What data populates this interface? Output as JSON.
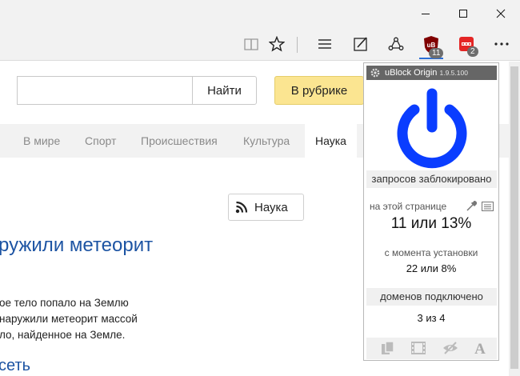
{
  "window_controls": {
    "minimize": "minimize-icon",
    "maximize": "maximize-icon",
    "close": "close-icon"
  },
  "toolbar": {
    "reading_view": "book-icon",
    "favorite": "star-icon",
    "hub": "hamburger-icon",
    "notes": "pen-icon",
    "share": "share-icon",
    "ublock_badge": "11",
    "ext2_badge": "2",
    "more": "more-icon"
  },
  "page": {
    "search_placeholder": "",
    "search_button": "Найти",
    "rubric_button": "В рубрике",
    "tabs": [
      "В мире",
      "Спорт",
      "Происшествия",
      "Культура",
      "Наука"
    ],
    "active_tab": "Наука",
    "rss_button": "Наука",
    "headline": "ружили метеорит",
    "snippet_lines": [
      "ое тело попало на Землю",
      "наружили метеорит массой",
      "ло, найденное на Земле."
    ],
    "bottom_link": "сеть"
  },
  "ublock": {
    "name": "uBlock Origin",
    "version": "1.9.5.100",
    "requests_blocked": "запросов заблокировано",
    "on_this_page": "на этой странице",
    "page_count": "11 или 13%",
    "since_install": "с момента установки",
    "install_count": "22 или 8%",
    "domains_connected": "доменов подключено",
    "domains_count": "3 из 4",
    "accent_color": "#0a3dff",
    "tools": [
      "copy-icon",
      "film-icon",
      "eye-slash-icon",
      "font-icon"
    ]
  }
}
